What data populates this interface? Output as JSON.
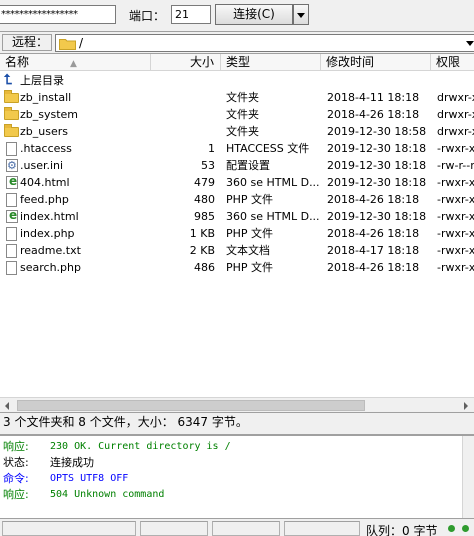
{
  "quickconnect": {
    "password_value": "*****************",
    "port_label": "端口：",
    "port_value": "21",
    "connect_label": "连接(C)"
  },
  "remote": {
    "label": "远程：",
    "path": "/"
  },
  "columns": {
    "name": "名称",
    "size": "大小",
    "type": "类型",
    "modified": "修改时间",
    "permissions": "权限"
  },
  "files": [
    {
      "name": "上层目录",
      "size": "",
      "type": "",
      "modified": "",
      "perm": "",
      "icon": "parent-dir"
    },
    {
      "name": "zb_install",
      "size": "",
      "type": "文件夹",
      "modified": "2018-4-11 18:18",
      "perm": "drwxr-x",
      "icon": "folder"
    },
    {
      "name": "zb_system",
      "size": "",
      "type": "文件夹",
      "modified": "2018-4-26 18:18",
      "perm": "drwxr-x",
      "icon": "folder"
    },
    {
      "name": "zb_users",
      "size": "",
      "type": "文件夹",
      "modified": "2019-12-30 18:58",
      "perm": "drwxr-x",
      "icon": "folder"
    },
    {
      "name": ".htaccess",
      "size": "1",
      "type": "HTACCESS 文件",
      "modified": "2019-12-30 18:18",
      "perm": "-rwxr-x",
      "icon": "file"
    },
    {
      "name": ".user.ini",
      "size": "53",
      "type": "配置设置",
      "modified": "2019-12-30 18:18",
      "perm": "-rw-r--r",
      "icon": "settings-file"
    },
    {
      "name": "404.html",
      "size": "479",
      "type": "360 se HTML D...",
      "modified": "2019-12-30 18:18",
      "perm": "-rwxr-x",
      "icon": "html-file"
    },
    {
      "name": "feed.php",
      "size": "480",
      "type": "PHP 文件",
      "modified": "2018-4-26 18:18",
      "perm": "-rwxr-x",
      "icon": "file"
    },
    {
      "name": "index.html",
      "size": "985",
      "type": "360 se HTML D...",
      "modified": "2019-12-30 18:18",
      "perm": "-rwxr-x",
      "icon": "html-file"
    },
    {
      "name": "index.php",
      "size": "1 KB",
      "type": "PHP 文件",
      "modified": "2018-4-26 18:18",
      "perm": "-rwxr-x",
      "icon": "file"
    },
    {
      "name": "readme.txt",
      "size": "2 KB",
      "type": "文本文档",
      "modified": "2018-4-17 18:18",
      "perm": "-rwxr-x",
      "icon": "file"
    },
    {
      "name": "search.php",
      "size": "486",
      "type": "PHP 文件",
      "modified": "2018-4-26 18:18",
      "perm": "-rwxr-x",
      "icon": "file"
    }
  ],
  "summary": "3 个文件夹和 8 个文件，大小： 6347 字节。",
  "log": [
    {
      "label": "响应:",
      "message": "230 OK. Current directory is /",
      "color": "#008000",
      "mono": true
    },
    {
      "label": "状态:",
      "message": "连接成功",
      "color": "#000000",
      "mono": false
    },
    {
      "label": "命令:",
      "message": "OPTS UTF8 OFF",
      "color": "#0000ff",
      "mono": true
    },
    {
      "label": "响应:",
      "message": "504 Unknown command",
      "color": "#008000",
      "mono": true
    }
  ],
  "statusbar": {
    "queue": "队列：0 字节"
  }
}
